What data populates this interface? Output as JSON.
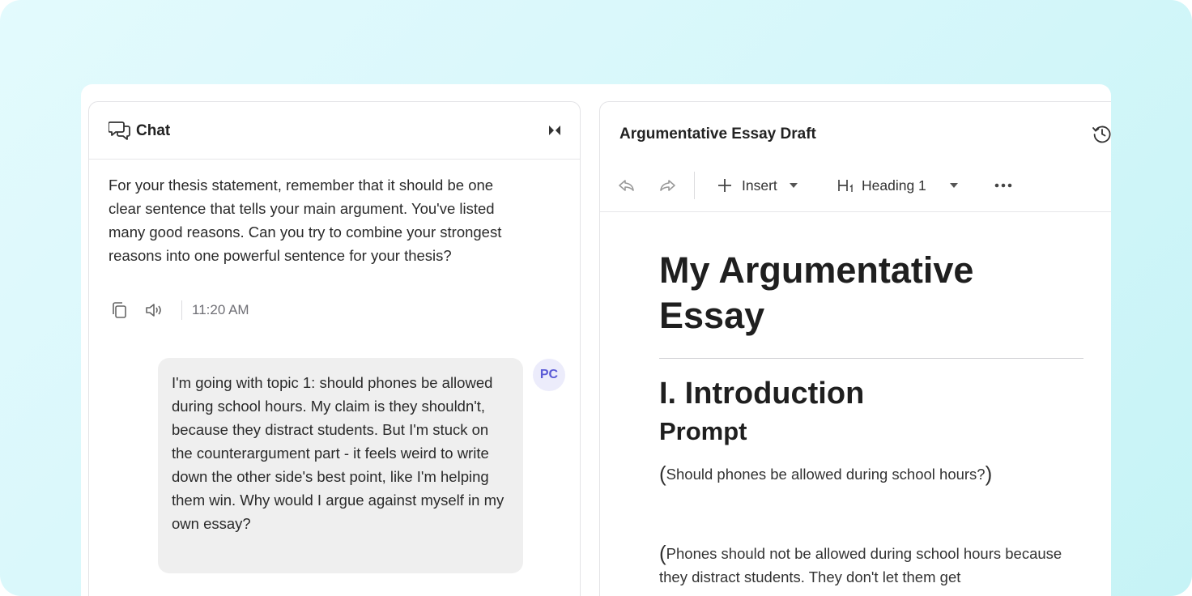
{
  "chat": {
    "title": "Chat",
    "assistant_message": "For your thesis statement, remember that it should be one clear sentence that tells your main argument. You've listed many good reasons. Can you try to combine your strongest reasons into one powerful sentence for your thesis?",
    "timestamp": "11:20 AM",
    "user_message": "I'm going with topic 1: should phones be allowed during school hours. My claim is they shouldn't, because they distract students. But I'm stuck on the counterargument part - it feels weird to write down the other side's best point, like I'm helping them win. Why would I argue against myself in my own essay?",
    "user_initials": "PC"
  },
  "editor": {
    "title": "Argumentative Essay Draft",
    "toolbar": {
      "insert_label": "Insert",
      "heading_label": "Heading 1"
    },
    "document": {
      "title": "My Argumentative Essay",
      "section_heading": "I. Introduction",
      "subheading": "Prompt",
      "prompt_text": "Should phones be allowed during school hours?",
      "paragraph_text": "Phones should not be allowed during school hours because they distract students. They don't let them get"
    }
  },
  "colors": {
    "background_gradient": [
      "#e3fafd",
      "#c6f3f6"
    ],
    "avatar_bg": "#ececfb",
    "avatar_text": "#5b5bd6",
    "user_bubble": "#efefef"
  },
  "icons": [
    "chat-bubbles-icon",
    "collapse-icon",
    "copy-icon",
    "speaker-icon",
    "history-icon",
    "undo-icon",
    "redo-icon",
    "plus-icon",
    "chevron-down-icon",
    "heading-icon",
    "more-icon"
  ]
}
